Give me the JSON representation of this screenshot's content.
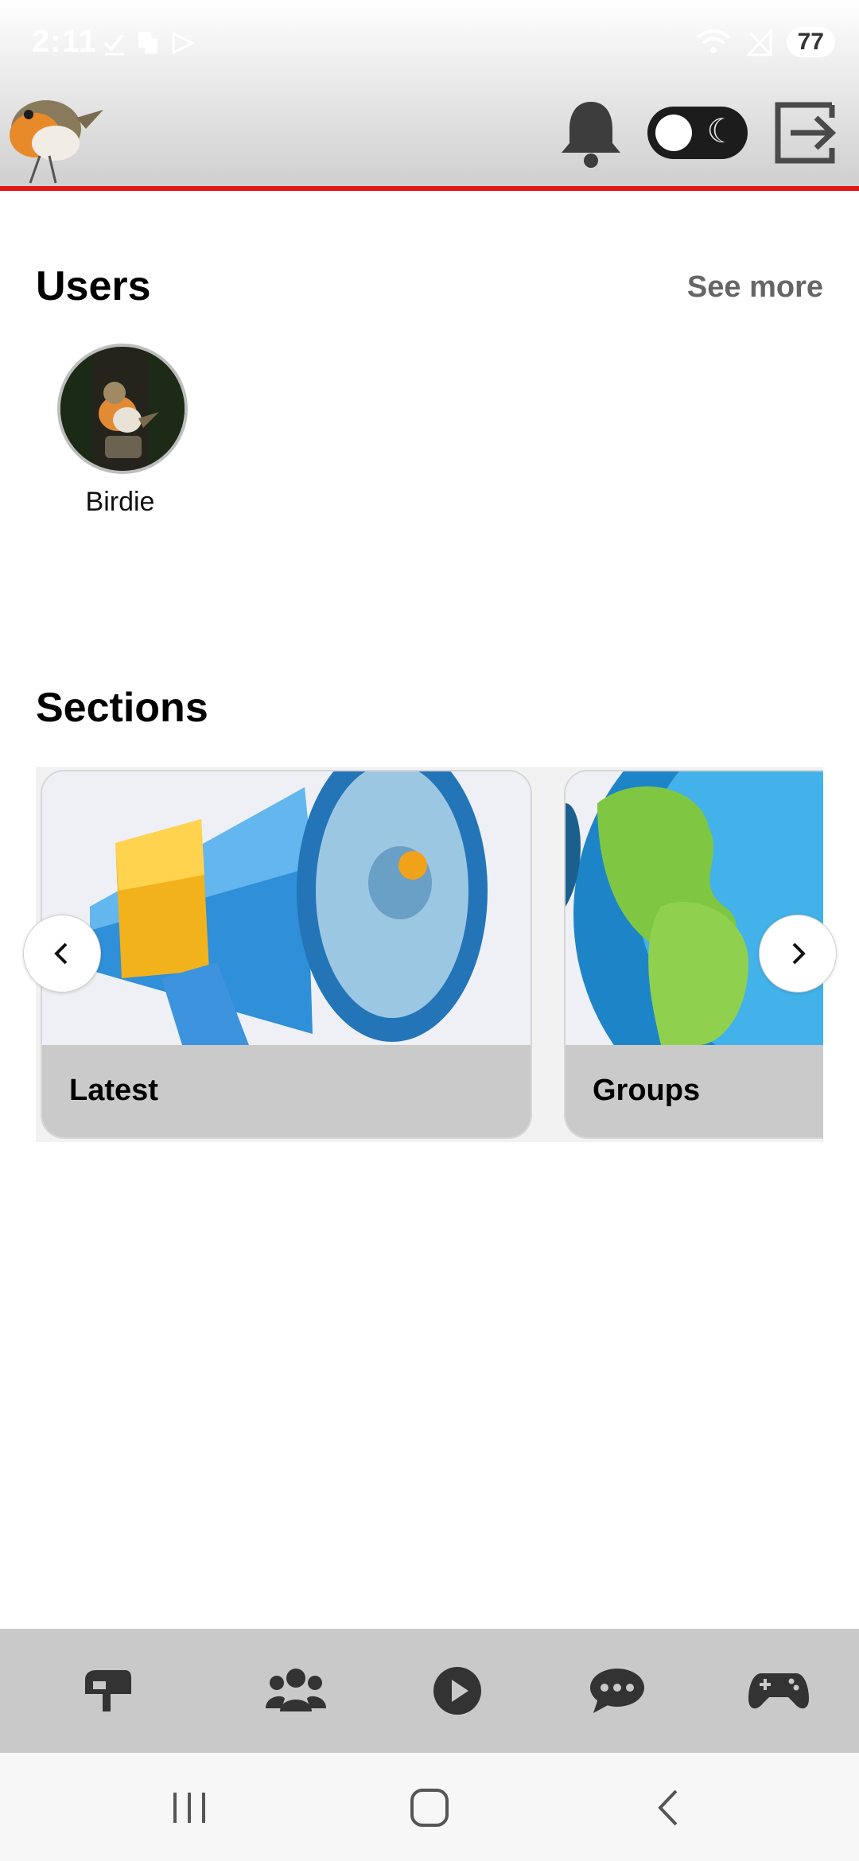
{
  "status_bar": {
    "time": "2:11",
    "battery": "77"
  },
  "users_section": {
    "title": "Users",
    "see_more": "See more",
    "users": [
      {
        "name": "Birdie"
      }
    ]
  },
  "sections_section": {
    "title": "Sections",
    "cards": [
      {
        "label": "Latest",
        "icon": "megaphone"
      },
      {
        "label": "Groups",
        "icon": "globe"
      }
    ]
  },
  "bottom_nav": {
    "items": [
      {
        "icon": "mailbox-icon"
      },
      {
        "icon": "users-icon"
      },
      {
        "icon": "play-icon"
      },
      {
        "icon": "chat-icon"
      },
      {
        "icon": "gamepad-icon"
      }
    ]
  },
  "colors": {
    "accent_line": "#e01818",
    "nav_background": "#c9c9c9",
    "card_label_background": "#cacaca"
  }
}
